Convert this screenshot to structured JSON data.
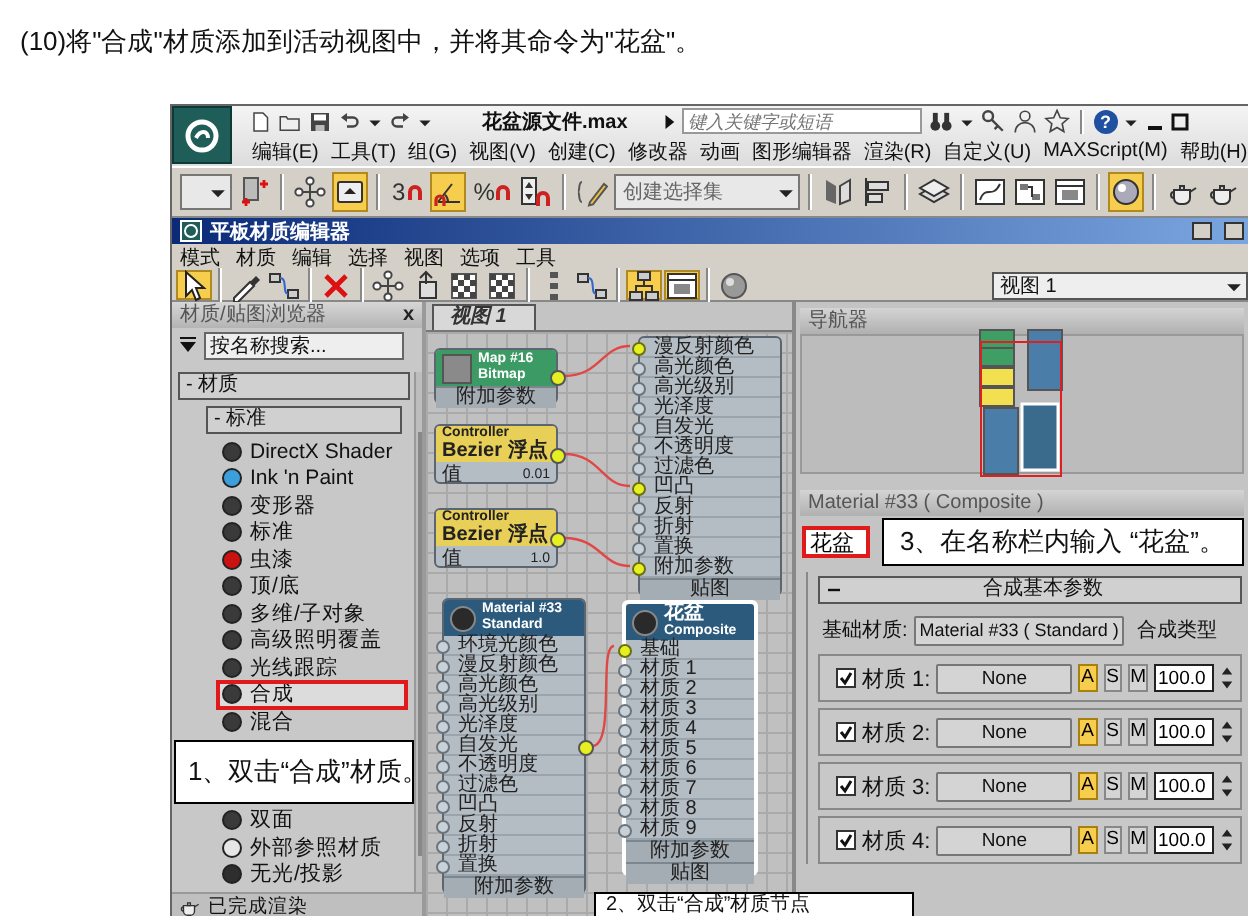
{
  "instruction": "(10)将\"合成\"材质添加到活动视图中，并将其命令为\"花盆\"。",
  "app": {
    "title": "花盆源文件.max",
    "search": {
      "placeholder": "键入关键字或短语"
    },
    "help": "?",
    "menu": [
      "编辑(E)",
      "工具(T)",
      "组(G)",
      "视图(V)",
      "创建(C)",
      "修改器",
      "动画",
      "图形编辑器",
      "渲染(R)",
      "自定义(U)",
      "MAXScript(M)",
      "帮助(H)"
    ],
    "toolbar": [
      {
        "kind": "picker",
        "on": false
      },
      {
        "kind": "link",
        "on": false
      },
      {
        "kind": "separator"
      },
      {
        "kind": "move",
        "on": false
      },
      {
        "kind": "select",
        "on": true
      },
      {
        "kind": "separator"
      },
      {
        "kind": "snap",
        "label": "3",
        "on": false
      },
      {
        "kind": "angle",
        "on": true
      },
      {
        "kind": "snap",
        "label": "%",
        "on": false
      },
      {
        "kind": "spinner",
        "on": false
      },
      {
        "kind": "separator"
      },
      {
        "kind": "named",
        "on": false
      },
      {
        "kind": "combo",
        "value": "创建选择集",
        "on": false
      },
      {
        "kind": "separator"
      },
      {
        "kind": "mirror",
        "on": false
      },
      {
        "kind": "align",
        "on": false
      },
      {
        "kind": "separator"
      },
      {
        "kind": "layers",
        "on": false
      },
      {
        "kind": "separator"
      },
      {
        "kind": "graph",
        "on": false
      },
      {
        "kind": "schematic",
        "on": false
      },
      {
        "kind": "window",
        "on": false
      },
      {
        "kind": "separator"
      },
      {
        "kind": "editor",
        "on": true
      },
      {
        "kind": "separator"
      },
      {
        "kind": "teapot",
        "on": false
      },
      {
        "kind": "teapot",
        "on": false
      }
    ]
  },
  "editor": {
    "title": "平板材质编辑器",
    "menu": [
      "模式",
      "材质",
      "编辑",
      "选择",
      "视图",
      "选项",
      "工具"
    ],
    "toolbar": [
      {
        "kind": "pointer",
        "on": true
      },
      {
        "kind": "separator"
      },
      {
        "kind": "eyedropper",
        "on": false
      },
      {
        "kind": "nodes",
        "on": false
      },
      {
        "kind": "separator"
      },
      {
        "kind": "delete",
        "on": false
      },
      {
        "kind": "separator"
      },
      {
        "kind": "move",
        "on": false
      },
      {
        "kind": "arrowbox",
        "on": false
      },
      {
        "kind": "checker",
        "on": false
      },
      {
        "kind": "checker",
        "on": false
      },
      {
        "kind": "separator"
      },
      {
        "kind": "dots",
        "on": false
      },
      {
        "kind": "nodes",
        "on": false
      },
      {
        "kind": "separator"
      },
      {
        "kind": "layout",
        "on": true
      },
      {
        "kind": "window",
        "on": true
      },
      {
        "kind": "separator"
      },
      {
        "kind": "sphere",
        "on": false
      }
    ],
    "view_select": "视图 1",
    "browser": {
      "title": "材质/贴图浏览器",
      "close": "x",
      "search": {
        "placeholder": "按名称搜索..."
      },
      "category": {
        "label": "- 材质",
        "expanded": true
      },
      "group": {
        "label": "- 标准",
        "expanded": true
      },
      "items": [
        {
          "label": "DirectX Shader",
          "color": "#3a3a3a",
          "selected": false
        },
        {
          "label": "Ink 'n Paint",
          "color": "#3c9fdc",
          "selected": false
        },
        {
          "label": "变形器",
          "color": "#3a3a3a",
          "selected": false
        },
        {
          "label": "标准",
          "color": "#3a3a3a",
          "selected": false
        },
        {
          "label": "虫漆",
          "color": "#cc1111",
          "selected": false
        },
        {
          "label": "顶/底",
          "color": "#3a3a3a",
          "selected": false
        },
        {
          "label": "多维/子对象",
          "color": "#3a3a3a",
          "selected": false
        },
        {
          "label": "高级照明覆盖",
          "color": "#3a3a3a",
          "selected": false
        },
        {
          "label": "光线跟踪",
          "color": "#3a3a3a",
          "selected": false
        },
        {
          "label": "合成",
          "color": "#3a3a3a",
          "selected": true
        },
        {
          "label": "混合",
          "color": "#3a3a3a",
          "selected": false
        }
      ],
      "callout": "1、双击“合成”材质。",
      "more_items": [
        {
          "label": "双面",
          "color": "#3a3a3a",
          "selected": false
        },
        {
          "label": "外部参照材质",
          "color": "#e6e6e6",
          "selected": false
        },
        {
          "label": "无光/投影",
          "color": "#2e2e2e",
          "selected": false
        }
      ],
      "status": "已完成渲染"
    },
    "graph": {
      "tab": "视图 1",
      "nodes": [
        {
          "kind": "ports",
          "selected": false,
          "output": false,
          "ports": [
            {
              "label": "漫反射颜色",
              "connected": true
            },
            {
              "label": "高光颜色",
              "connected": false
            },
            {
              "label": "高光级别",
              "connected": false
            },
            {
              "label": "光泽度",
              "connected": false
            },
            {
              "label": "自发光",
              "connected": false
            },
            {
              "label": "不透明度",
              "connected": false
            },
            {
              "label": "过滤色",
              "connected": false
            },
            {
              "label": "凹凸",
              "connected": true
            },
            {
              "label": "反射",
              "connected": false
            },
            {
              "label": "折射",
              "connected": false
            },
            {
              "label": "置换",
              "connected": false
            },
            {
              "label": "附加参数",
              "connected": true
            }
          ],
          "footer": [
            "贴图"
          ]
        },
        {
          "kind": "map",
          "selected": false,
          "output": true,
          "title": "Map #16",
          "subtitle": "Bitmap",
          "footer": [
            "附加参数"
          ]
        },
        {
          "kind": "controller",
          "selected": false,
          "output": true,
          "title": "Controller",
          "subtitle": "Bezier 浮点",
          "param": "值",
          "value": "0.01"
        },
        {
          "kind": "controller",
          "selected": false,
          "output": true,
          "title": "Controller",
          "subtitle": "Bezier 浮点",
          "param": "值",
          "value": "1.0"
        },
        {
          "kind": "material",
          "selected": false,
          "output": true,
          "title": "Material #33",
          "subtitle": "Standard",
          "ports": [
            {
              "label": "环境光颜色",
              "connected": false
            },
            {
              "label": "漫反射颜色",
              "connected": false
            },
            {
              "label": "高光颜色",
              "connected": false
            },
            {
              "label": "高光级别",
              "connected": false
            },
            {
              "label": "光泽度",
              "connected": false
            },
            {
              "label": "自发光",
              "connected": false
            },
            {
              "label": "不透明度",
              "connected": false
            },
            {
              "label": "过滤色",
              "connected": false
            },
            {
              "label": "凹凸",
              "connected": false
            },
            {
              "label": "反射",
              "connected": false
            },
            {
              "label": "折射",
              "connected": false
            },
            {
              "label": "置换",
              "connected": false
            }
          ],
          "footer": [
            "附加参数"
          ]
        },
        {
          "kind": "material",
          "selected": true,
          "output": false,
          "title": "花盆",
          "subtitle": "Composite",
          "ports": [
            {
              "label": "基础",
              "connected": true
            },
            {
              "label": "材质 1",
              "connected": false
            },
            {
              "label": "材质 2",
              "connected": false
            },
            {
              "label": "材质 3",
              "connected": false
            },
            {
              "label": "材质 4",
              "connected": false
            },
            {
              "label": "材质 5",
              "connected": false
            },
            {
              "label": "材质 6",
              "connected": false
            },
            {
              "label": "材质 7",
              "connected": false
            },
            {
              "label": "材质 8",
              "connected": false
            },
            {
              "label": "材质 9",
              "connected": false
            }
          ],
          "footer": [
            "附加参数",
            "贴图"
          ]
        }
      ],
      "callout": "2、双击“合成”材质节点"
    },
    "panel": {
      "navigator_title": "导航器",
      "material_title": "Material #33 ( Composite )",
      "name": "花盆",
      "callout": "3、在名称栏内输入 “花盆”。",
      "rollout": {
        "label": "合成基本参数",
        "expanded": true
      },
      "base_label": "基础材质:",
      "base_value": "Material #33 ( Standard )",
      "type_label": "合成类型",
      "rows": [
        {
          "checked": true,
          "label": "材质 1:",
          "map": "None",
          "modes": [
            {
              "label": "A",
              "selected": true
            },
            {
              "label": "S",
              "selected": false
            },
            {
              "label": "M",
              "selected": false
            }
          ],
          "amount": "100.0"
        },
        {
          "checked": true,
          "label": "材质 2:",
          "map": "None",
          "modes": [
            {
              "label": "A",
              "selected": true
            },
            {
              "label": "S",
              "selected": false
            },
            {
              "label": "M",
              "selected": false
            }
          ],
          "amount": "100.0"
        },
        {
          "checked": true,
          "label": "材质 3:",
          "map": "None",
          "modes": [
            {
              "label": "A",
              "selected": true
            },
            {
              "label": "S",
              "selected": false
            },
            {
              "label": "M",
              "selected": false
            }
          ],
          "amount": "100.0"
        },
        {
          "checked": true,
          "label": "材质 4:",
          "map": "None",
          "modes": [
            {
              "label": "A",
              "selected": true
            },
            {
              "label": "S",
              "selected": false
            },
            {
              "label": "M",
              "selected": false
            }
          ],
          "amount": "100.0"
        }
      ]
    }
  }
}
